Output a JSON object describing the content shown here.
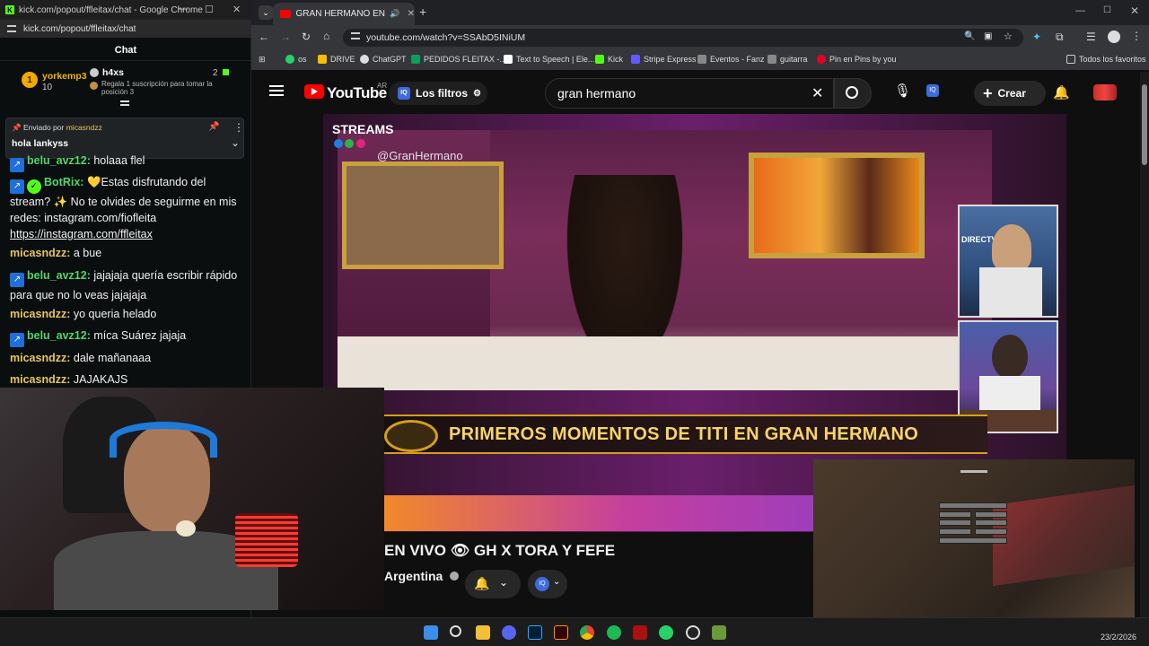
{
  "chat_window": {
    "title": "kick.com/popout/ffleitax/chat - Google Chrome",
    "url": "kick.com/popout/ffleitax/chat",
    "header": "Chat",
    "leaderboard": [
      {
        "rank": "1",
        "name": "yorkemp3",
        "count": "10"
      },
      {
        "name": "h4xs",
        "count": "2",
        "note": "Regala 1 suscripción para tomar la posición 3"
      }
    ],
    "pinned": {
      "label": "Enviado por",
      "user": "micasndzz",
      "text": "hola lankyss"
    },
    "messages": [
      {
        "user": "belu_avz12:",
        "text": "holaaa flel"
      },
      {
        "user": "BotRix:",
        "text": "💛Estas disfrutando del stream? ✨ No te olvides de seguirme en mis redes: instagram.com/fiofleita",
        "link": "https://instagram.com/ffleitax"
      },
      {
        "user": "micasndzz:",
        "text": "a bue"
      },
      {
        "user": "belu_avz12:",
        "text": "jajajaja quería escribir rápido para que no lo veas jajajaja"
      },
      {
        "user": "micasndzz:",
        "text": "yo queria helado"
      },
      {
        "user": "belu_avz12:",
        "text": "míca Suárez jajaja"
      },
      {
        "user": "micasndzz:",
        "text": "dale mañanaaa"
      },
      {
        "user": "micasndzz:",
        "text": "JAJAKAJS"
      }
    ]
  },
  "browser": {
    "tab_title": "GRAN HERMANO EN VIVO",
    "url": "youtube.com/watch?v=SSAbD5INiUM",
    "bookmarks": [
      "os",
      "DRIVE",
      "ChatGPT",
      "PEDIDOS FLEITAX -...",
      "Text to Speech | Ele...",
      "Kick",
      "Stripe Express",
      "Eventos - Fanz",
      "guitarra",
      "Pin en Pins by you"
    ],
    "all_bookmarks": "Todos los favoritos"
  },
  "youtube": {
    "logo": "YouTube",
    "region": "AR",
    "filters": "Los filtros",
    "search_value": "gran hermano",
    "create": "Crear",
    "video": {
      "streams_label": "STREAMS",
      "handle": "@GranHermano",
      "lower_third": "PRIMEROS MOMENTOS DE TITI EN GRAN HERMANO",
      "pip_label": "DIRECTV"
    },
    "title": "EN VIVO 👁 GH X TORA Y FEFE",
    "channel": "Argentina"
  },
  "taskbar": {
    "date": "23/2/2026"
  },
  "colors": {
    "kick_green": "#53fc18",
    "yt_red": "#ff0000",
    "gold": "#f7d469"
  }
}
